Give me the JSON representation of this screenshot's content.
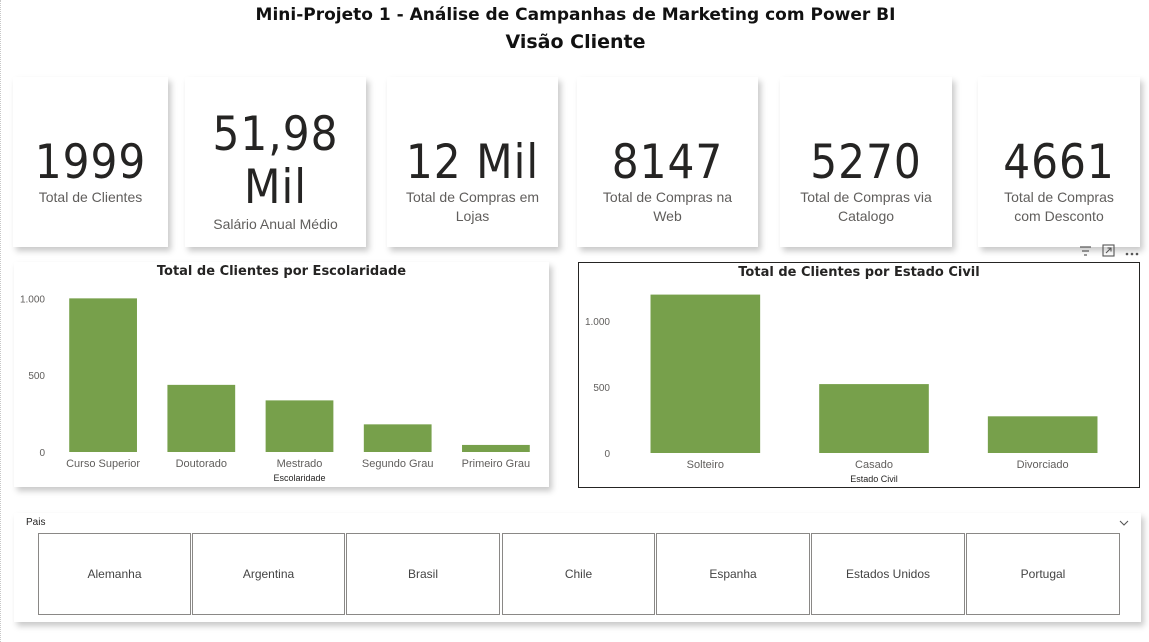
{
  "header": {
    "title": "Mini-Projeto 1 - Análise de Campanhas de Marketing com Power BI",
    "subtitle": "Visão Cliente"
  },
  "cards": [
    {
      "value": "1999",
      "label": "Total de Clientes"
    },
    {
      "value_line1": "51,98",
      "value_line2": "Mil",
      "label": "Salário Anual Médio"
    },
    {
      "value": "12 Mil",
      "label_line1": "Total de Compras em",
      "label_line2": "Lojas"
    },
    {
      "value": "8147",
      "label_line1": "Total de Compras na",
      "label_line2": "Web"
    },
    {
      "value": "5270",
      "label_line1": "Total de Compras via",
      "label_line2": "Catalogo"
    },
    {
      "value": "4661",
      "label_line1": "Total de Compras",
      "label_line2": "com Desconto"
    }
  ],
  "visual_header_icons": [
    "filter-icon",
    "focus-mode-icon",
    "more-options-icon"
  ],
  "chart_data": [
    {
      "type": "bar",
      "title": "Total de Clientes por Escolaridade",
      "xlabel": "Escolaridade",
      "ylabel": "",
      "categories": [
        "Curso Superior",
        "Doutorado",
        "Mestrado",
        "Segundo Grau",
        "Primeiro Grau"
      ],
      "values": [
        1000,
        437,
        336,
        180,
        46
      ],
      "yticks": [
        "0",
        "500",
        "1.000"
      ],
      "ylim": [
        0,
        1100
      ],
      "bar_color": "#77A04B",
      "grid": false
    },
    {
      "type": "bar",
      "title": "Total de Clientes por Estado Civil",
      "xlabel": "Estado Civil",
      "ylabel": "",
      "categories": [
        "Solteiro",
        "Casado",
        "Divorciado"
      ],
      "values": [
        1200,
        522,
        278
      ],
      "yticks": [
        "0",
        "500",
        "1.000"
      ],
      "ylim": [
        0,
        1250
      ],
      "bar_color": "#77A04B",
      "grid": false
    }
  ],
  "slicer": {
    "header": "Pais",
    "chevron_icon": "chevron-down-icon",
    "options": [
      "Alemanha",
      "Argentina",
      "Brasil",
      "Chile",
      "Espanha",
      "Estados Unidos",
      "Portugal"
    ]
  }
}
